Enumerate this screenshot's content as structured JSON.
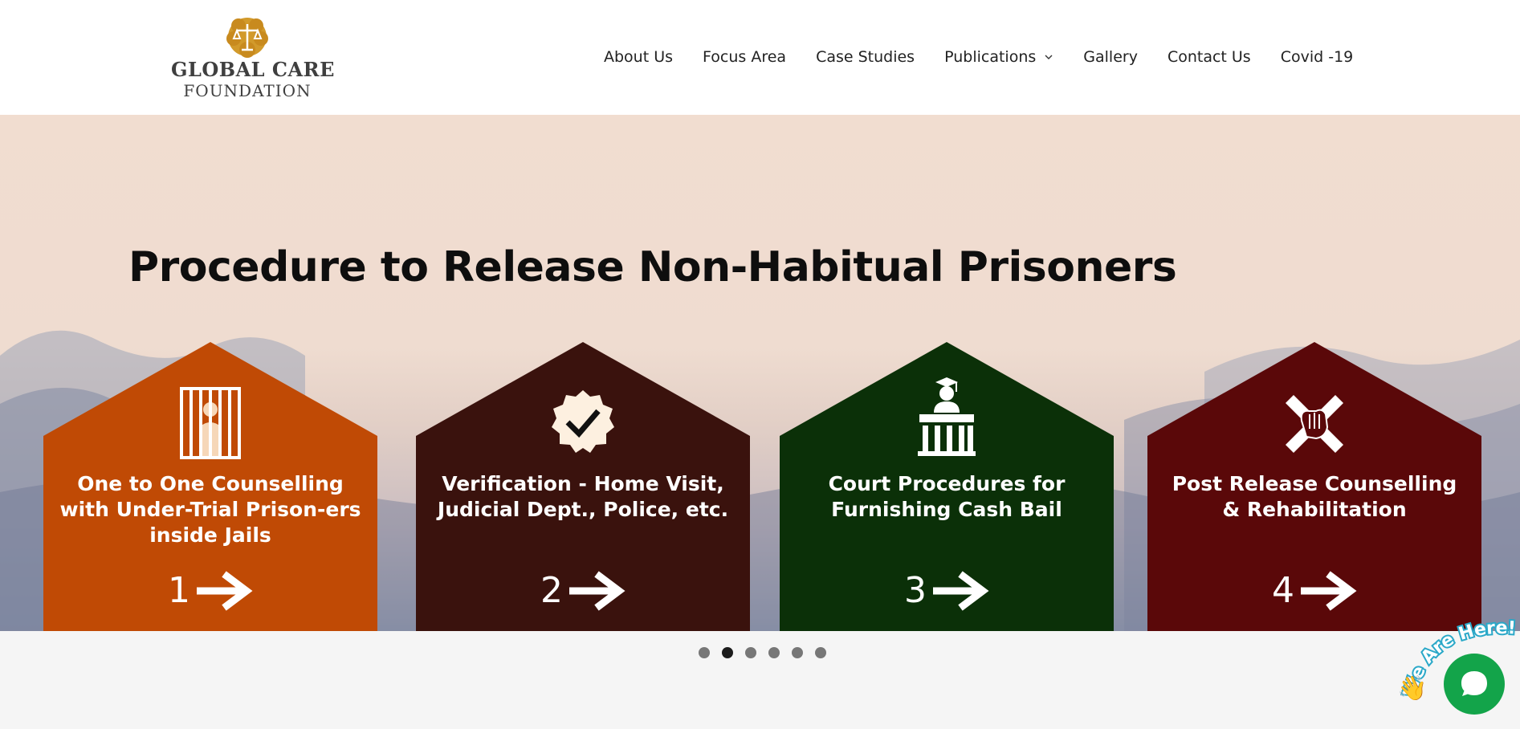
{
  "header": {
    "logo": {
      "title": "GLOBAL CARE",
      "subtitle": "FOUNDATION",
      "icon": "scales-of-justice-logo"
    },
    "nav": [
      {
        "label": "About Us"
      },
      {
        "label": "Focus Area"
      },
      {
        "label": "Case Studies"
      },
      {
        "label": "Publications",
        "has_dropdown": true
      },
      {
        "label": "Gallery"
      },
      {
        "label": "Contact Us"
      },
      {
        "label": "Covid -19"
      }
    ]
  },
  "hero": {
    "title": "Procedure to Release Non-Habitual Prisoners",
    "cards": [
      {
        "text": "One to One Counselling with Under-Trial Prison-ers inside Jails",
        "number": "1",
        "color": "#c04a05",
        "icon": "prisoner-behind-bars-icon"
      },
      {
        "text": "Verification - Home Visit, Judicial Dept., Police, etc.",
        "number": "2",
        "color": "#3a120d",
        "icon": "verified-badge-icon"
      },
      {
        "text": "Court Procedures for Furnishing Cash Bail",
        "number": "3",
        "color": "#0b3008",
        "icon": "court-judge-icon"
      },
      {
        "text": "Post Release Counselling & Rehabilitation",
        "number": "4",
        "color": "#5a0809",
        "icon": "hands-cross-icon"
      }
    ]
  },
  "slider": {
    "dot_count": 6,
    "active_index": 1
  },
  "chat": {
    "tagline": "We Are Here!",
    "button_color": "#13a44a"
  }
}
